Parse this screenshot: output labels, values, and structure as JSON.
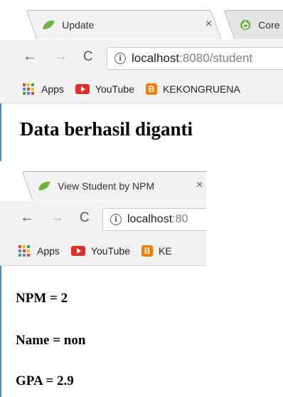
{
  "window1": {
    "tabs": [
      {
        "label": "Update",
        "icon": "spring-leaf-icon",
        "close": "×"
      },
      {
        "label": "Core",
        "icon": "spring-power-icon"
      }
    ],
    "url": {
      "host": "localhost",
      "rest": ":8080/student"
    },
    "bookmarks": [
      {
        "label": "Apps",
        "icon": "apps-grid-icon"
      },
      {
        "label": "YouTube",
        "icon": "youtube-icon"
      },
      {
        "label": "KEKONGRUENA",
        "icon": "blogger-icon"
      }
    ],
    "page": {
      "message": "Data berhasil diganti"
    }
  },
  "window2": {
    "tabs": [
      {
        "label": "View Student by NPM",
        "icon": "spring-leaf-icon",
        "close": "×"
      }
    ],
    "url": {
      "host": "localhost",
      "rest": ":80"
    },
    "bookmarks": [
      {
        "label": "Apps",
        "icon": "apps-grid-icon"
      },
      {
        "label": "YouTube",
        "icon": "youtube-icon"
      },
      {
        "label": "KE",
        "icon": "blogger-icon"
      }
    ],
    "student": {
      "npm": "NPM = 2",
      "name": "Name = non",
      "gpa": "GPA = 2.9"
    }
  },
  "colors": {
    "spring_green": "#6db33f",
    "youtube_red": "#e52d27",
    "blogger_orange": "#f57d00",
    "edge_blue": "#3e8fd6"
  },
  "nav": {
    "back": "←",
    "forward": "→",
    "reload": "C",
    "info": "i"
  }
}
